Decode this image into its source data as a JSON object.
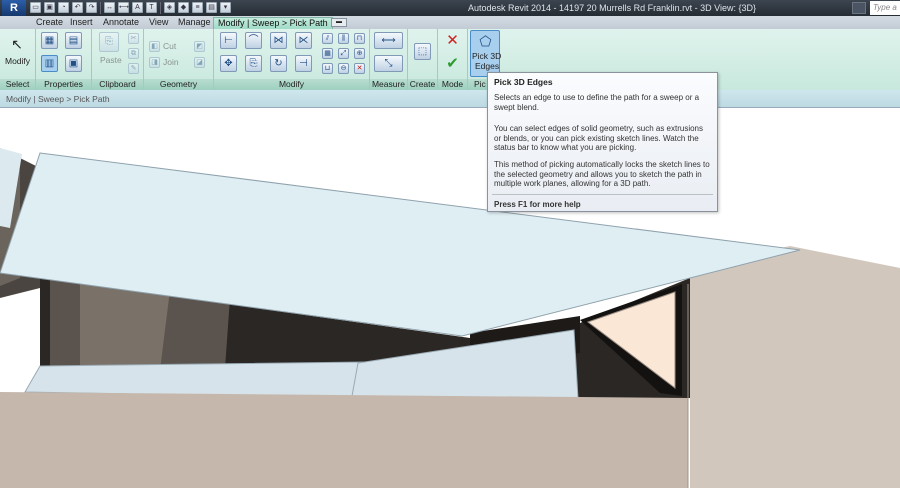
{
  "window": {
    "app_logo": "R",
    "title": "Autodesk Revit 2014 -    14197 20 Murrells Rd Franklin.rvt - 3D View: {3D}",
    "search_placeholder": "Type a k"
  },
  "tabs": [
    {
      "label": "Create"
    },
    {
      "label": "Insert"
    },
    {
      "label": "Annotate"
    },
    {
      "label": "View"
    },
    {
      "label": "Manage"
    },
    {
      "label": "Modify | Sweep > Pick Path",
      "active": true
    }
  ],
  "ribbon": {
    "modify_label": "Modify",
    "paste_label": "Paste",
    "cut_label": "Cut",
    "join_label": "Join",
    "pick_3d_edges_label_1": "Pick 3D",
    "pick_3d_edges_label_2": "Edges",
    "panels": {
      "select": "Select",
      "properties": "Properties",
      "clipboard": "Clipboard",
      "geometry": "Geometry",
      "modify": "Modify",
      "measure": "Measure",
      "create": "Create",
      "mode": "Mode",
      "pick": "Pic"
    }
  },
  "options_bar": {
    "breadcrumb": "Modify | Sweep > Pick Path"
  },
  "tooltip": {
    "title": "Pick 3D Edges",
    "p1": "Selects an edge to use to define the path for a sweep or a swept blend.",
    "p2": "You can select edges of solid geometry, such as extrusions or blends, or you can pick existing sketch lines. Watch the status bar to know what you are picking.",
    "p3": "This method of picking automatically locks the sketch lines to the selected geometry and allows you to sketch the path in multiple work planes, allowing for a 3D path.",
    "footer": "Press F1 for more help"
  },
  "colors": {
    "ribbon_bg": "#d4ede5",
    "contextual_tab": "#b3e3d2",
    "roof_face": "#dfeef3",
    "wall_face": "#cdbfb3",
    "tooltip_bg": "#f3f5f8"
  }
}
